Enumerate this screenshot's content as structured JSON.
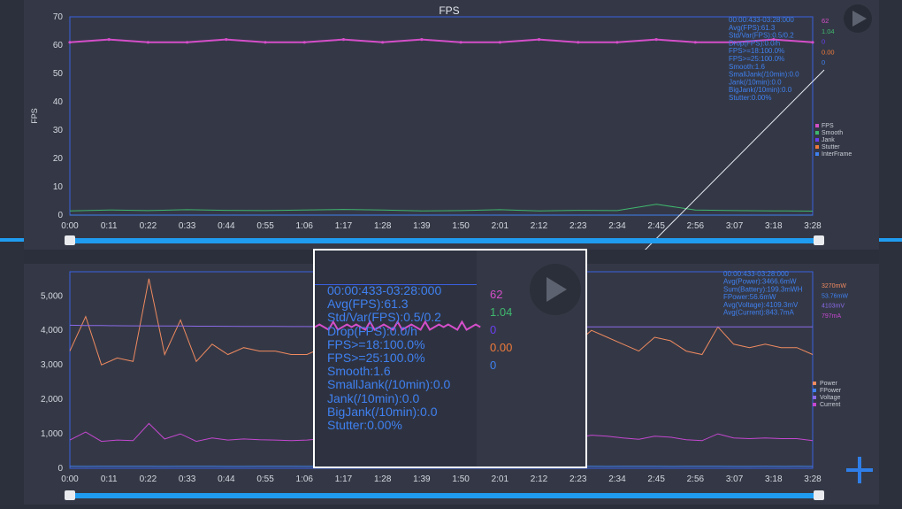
{
  "colors": {
    "fps": "#d44ec9",
    "smooth": "#3fb86e",
    "jank": "#6a3ff0",
    "stutter": "#f07a3a",
    "interframe": "#3f80f0",
    "power": "#f08a60",
    "fpower": "#3f80f0",
    "voltage": "#8a6ae8",
    "current": "#c447d0",
    "accent": "#1f9cf0",
    "frame": "#3a5fe0"
  },
  "fps_chart": {
    "title": "FPS",
    "ylabel": "FPS",
    "legend": [
      "FPS",
      "Smooth",
      "Jank",
      "Stutter",
      "InterFrame"
    ],
    "stats": [
      "00:00:433-03:28:000",
      "Avg(FPS):61.3",
      "Std/Var(FPS):0.5/0.2",
      "Drop(FPS):0.0/h",
      "FPS>=18:100.0%",
      "FPS>=25:100.0%",
      "Smooth:1.6",
      "SmallJank(/10min):0.0",
      "Jank(/10min):0.0",
      "BigJank(/10min):0.0",
      "Stutter:0.00%"
    ],
    "current_values": [
      "62",
      "1.04",
      "0",
      "0.00",
      "0"
    ]
  },
  "power_chart": {
    "legend": [
      "Power",
      "FPower",
      "Voltage",
      "Current"
    ],
    "stats": [
      "00:00:433-03:28:000",
      "Avg(Power):3466.6mW",
      "Sum(Battery):199.3mWH",
      "FPower:56.6mW",
      "Avg(Voltage):4109.3mV",
      "Avg(Current):843.7mA"
    ],
    "current_values": [
      "3270mW",
      "53.76mW",
      "4103mV",
      "797mA"
    ]
  },
  "chart_data": [
    {
      "type": "line",
      "title": "FPS",
      "ylabel": "FPS",
      "xlabel": "",
      "ylim": [
        0,
        70
      ],
      "yticks": [
        0,
        10,
        20,
        30,
        40,
        50,
        60,
        70
      ],
      "x_ticks": [
        "0:00",
        "0:11",
        "0:22",
        "0:33",
        "0:44",
        "0:55",
        "1:06",
        "1:17",
        "1:28",
        "1:39",
        "1:50",
        "2:01",
        "2:12",
        "2:23",
        "2:34",
        "2:45",
        "2:56",
        "3:07",
        "3:18",
        "3:28"
      ],
      "series": [
        {
          "name": "FPS",
          "values": [
            61,
            62,
            61,
            61,
            62,
            61,
            61,
            62,
            61,
            62,
            61,
            61,
            62,
            61,
            61,
            62,
            61,
            61,
            62,
            61
          ]
        },
        {
          "name": "Smooth",
          "values": [
            1.5,
            1.8,
            1.6,
            1.9,
            1.7,
            1.6,
            1.8,
            2.0,
            1.8,
            1.5,
            1.6,
            1.9,
            1.5,
            1.7,
            1.6,
            3.8,
            1.8,
            1.6,
            1.5,
            1.4
          ]
        },
        {
          "name": "Jank",
          "values": [
            0,
            0,
            0,
            0,
            0,
            0,
            0,
            0,
            0,
            0,
            0,
            0,
            0,
            0,
            0,
            0,
            0,
            0,
            0,
            0
          ]
        },
        {
          "name": "Stutter",
          "values": [
            0,
            0,
            0,
            0,
            0,
            0,
            0,
            0,
            0,
            0,
            0,
            0,
            0,
            0,
            0,
            0,
            0,
            0,
            0,
            0
          ]
        },
        {
          "name": "InterFrame",
          "values": [
            0,
            0,
            0,
            0,
            0,
            0,
            0,
            0,
            0,
            0,
            0,
            0,
            0,
            0,
            0,
            0,
            0,
            0,
            0,
            0
          ]
        }
      ]
    },
    {
      "type": "line",
      "title": "",
      "xlabel": "",
      "ylabel": "",
      "ylim": [
        0,
        5700
      ],
      "yticks": [
        0,
        1000,
        2000,
        3000,
        4000,
        5000
      ],
      "ytick_labels": [
        "0",
        "1,000",
        "2,000",
        "3,000",
        "4,000",
        "5,000"
      ],
      "x_ticks": [
        "0:00",
        "0:11",
        "0:22",
        "0:33",
        "0:44",
        "0:55",
        "1:06",
        "1:17",
        "1:28",
        "1:39",
        "1:50",
        "2:01",
        "2:12",
        "2:23",
        "2:34",
        "2:45",
        "2:56",
        "3:07",
        "3:18",
        "3:28"
      ],
      "series": [
        {
          "name": "Power",
          "values": [
            3400,
            4400,
            3000,
            3200,
            3100,
            5500,
            3300,
            4300,
            3100,
            3600,
            3300,
            3500,
            3400,
            3400,
            3300,
            3300,
            3500,
            3600,
            3700,
            3800,
            3500,
            3300,
            3400,
            3500,
            3600,
            3500,
            3400,
            3700,
            3500,
            3400,
            3500,
            3700,
            3600,
            4000,
            3800,
            3600,
            3400,
            3800,
            3700,
            3400,
            3300,
            4100,
            3600,
            3500,
            3600,
            3500,
            3500,
            3300
          ]
        },
        {
          "name": "FPower",
          "values": [
            56,
            55,
            57,
            56,
            58,
            57,
            55,
            56,
            57,
            56,
            55,
            54,
            56,
            57,
            56,
            55,
            56,
            57,
            56,
            55,
            56,
            54,
            55,
            56,
            57,
            56,
            55,
            56,
            57,
            56,
            55,
            56,
            57,
            56,
            55,
            56,
            57,
            56,
            55,
            56,
            57,
            56,
            55,
            54,
            56,
            55,
            56,
            54
          ]
        },
        {
          "name": "Voltage",
          "values": [
            4150,
            4140,
            4140,
            4135,
            4130,
            4130,
            4125,
            4125,
            4120,
            4120,
            4118,
            4115,
            4115,
            4112,
            4110,
            4110,
            4108,
            4108,
            4106,
            4105,
            4105,
            4104,
            4104,
            4103,
            4103,
            4103,
            4103,
            4103,
            4103,
            4103,
            4103,
            4103,
            4103,
            4103,
            4103,
            4103,
            4103,
            4103,
            4103,
            4103,
            4103,
            4103,
            4103,
            4103,
            4103,
            4103,
            4103,
            4103
          ]
        },
        {
          "name": "Current",
          "values": [
            820,
            1050,
            780,
            820,
            800,
            1300,
            850,
            1000,
            780,
            880,
            820,
            850,
            830,
            820,
            800,
            820,
            860,
            880,
            900,
            930,
            860,
            820,
            840,
            860,
            880,
            860,
            840,
            900,
            860,
            830,
            860,
            900,
            880,
            960,
            930,
            880,
            840,
            930,
            900,
            830,
            800,
            1000,
            880,
            860,
            880,
            860,
            860,
            800
          ]
        }
      ]
    }
  ]
}
